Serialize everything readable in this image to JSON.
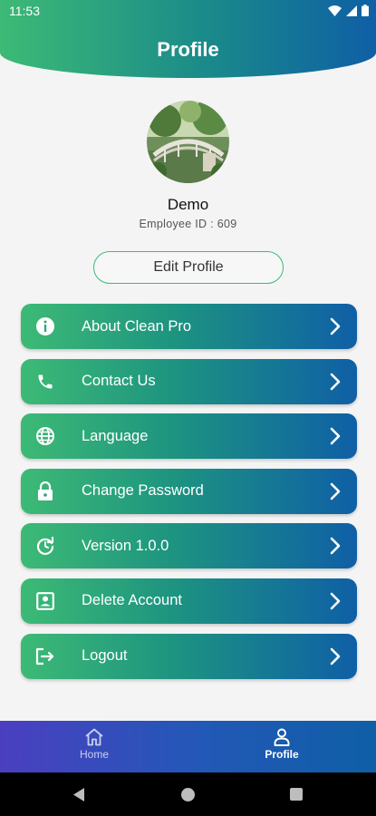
{
  "status": {
    "time": "11:53"
  },
  "header": {
    "title": "Profile"
  },
  "profile": {
    "name": "Demo",
    "employee_id": "Employee ID : 609",
    "edit_label": "Edit Profile"
  },
  "menu": [
    {
      "label": "About Clean Pro",
      "icon": "info-icon"
    },
    {
      "label": "Contact Us",
      "icon": "phone-icon"
    },
    {
      "label": "Language",
      "icon": "globe-icon"
    },
    {
      "label": "Change Password",
      "icon": "lock-icon"
    },
    {
      "label": "Version 1.0.0",
      "icon": "update-icon"
    },
    {
      "label": "Delete Account",
      "icon": "account-box-icon"
    },
    {
      "label": "Logout",
      "icon": "logout-icon"
    }
  ],
  "bottom_nav": [
    {
      "label": "Home",
      "icon": "home-icon",
      "active": false
    },
    {
      "label": "Profile",
      "icon": "person-icon",
      "active": true
    }
  ],
  "colors": {
    "gradient_start": "#3dba75",
    "gradient_end": "#0f5fa6",
    "nav_start": "#4b3fc0",
    "background": "#f4f4f4"
  }
}
